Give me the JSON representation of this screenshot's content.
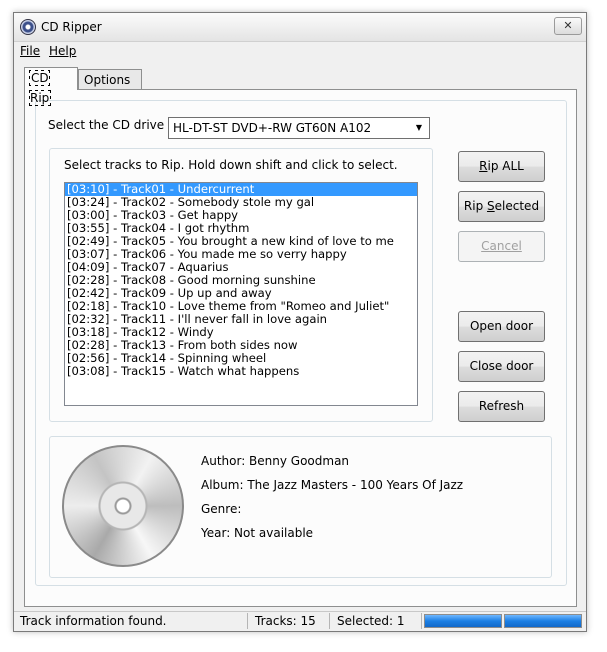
{
  "window": {
    "title": "CD Ripper",
    "close_glyph": "✕"
  },
  "menu": {
    "file": "File",
    "help": "Help"
  },
  "tabs": [
    {
      "label": "CD Rip"
    },
    {
      "label": "Options"
    }
  ],
  "drive": {
    "label": "Select the CD drive",
    "selected": "HL-DT-ST DVD+-RW GT60N A102"
  },
  "tracks": {
    "hint": "Select tracks to Rip. Hold down shift and click to select.",
    "items": [
      "[03:10] - Track01 - Undercurrent",
      "[03:24] - Track02 - Somebody stole my gal",
      "[03:00] - Track03 - Get happy",
      "[03:55] - Track04 - I got rhythm",
      "[02:49] - Track05 - You brought a new kind of love to me",
      "[03:07] - Track06 - You made me so verry happy",
      "[04:09] - Track07 - Aquarius",
      "[02:28] - Track08 - Good morning sunshine",
      "[02:42] - Track09 - Up up and away",
      "[02:18] - Track10 - Love theme from \"Romeo and Juliet\"",
      "[02:32] - Track11 - I'll never fall in love again",
      "[03:18] - Track12 - Windy",
      "[02:28] - Track13 - From both sides now",
      "[02:56] - Track14 - Spinning wheel",
      "[03:08] - Track15 - Watch what happens"
    ],
    "selected_index": 0
  },
  "buttons": {
    "rip_all": "Rip ALL",
    "rip_selected": "Rip Selected",
    "cancel": "Cancel",
    "open_door": "Open door",
    "close_door": "Close door",
    "refresh": "Refresh"
  },
  "info": {
    "author": "Author: Benny Goodman",
    "album": "Album: The Jazz Masters - 100 Years Of Jazz",
    "genre": "Genre:",
    "year": "Year: Not available"
  },
  "status": {
    "message": "Track information found.",
    "tracks": "Tracks: 15",
    "selected": "Selected: 1",
    "progress1": 1.0,
    "progress2": 1.0
  },
  "colors": {
    "selection": "#3399ff",
    "progress": "#1c7fe4"
  }
}
